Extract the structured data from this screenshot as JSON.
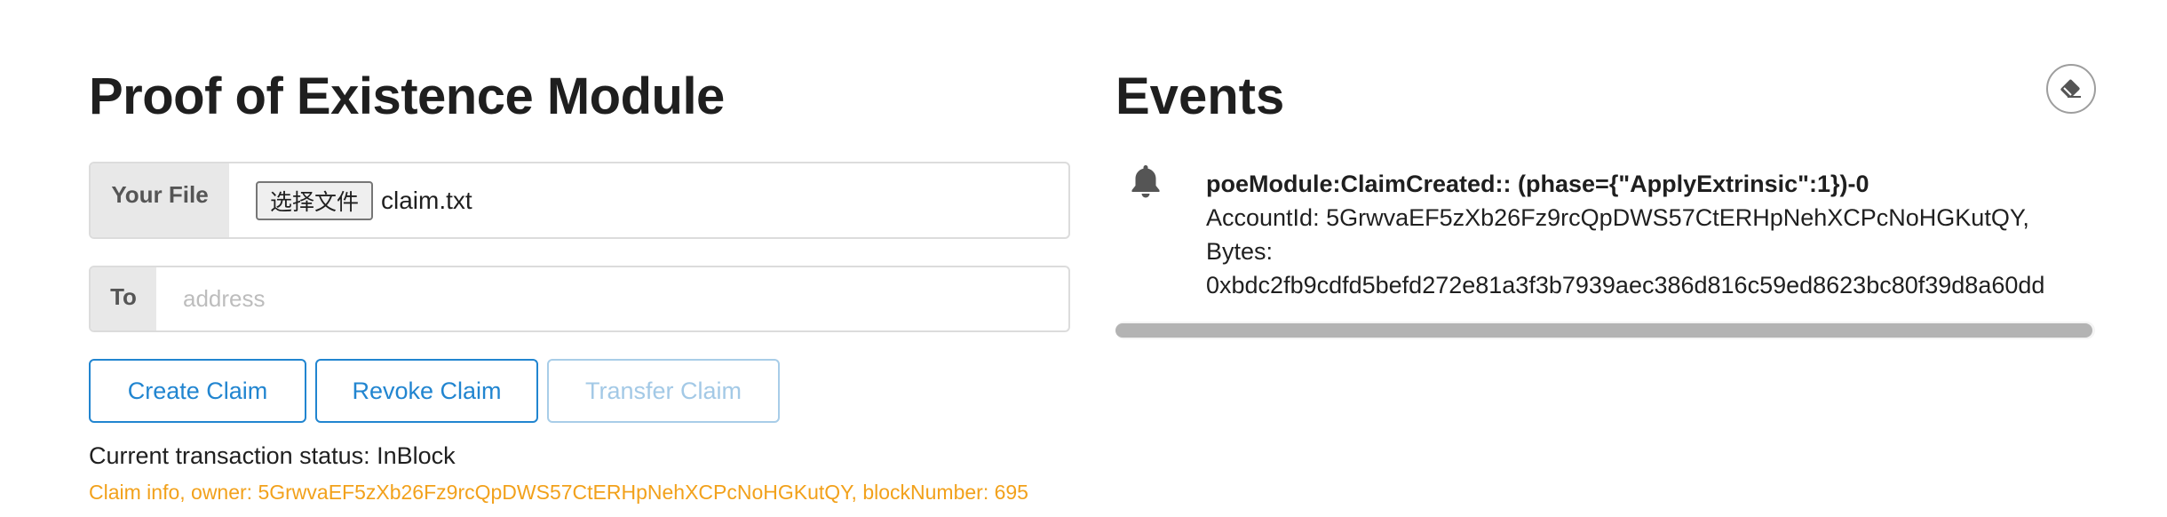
{
  "poe": {
    "title": "Proof of Existence Module",
    "file_label": "Your File",
    "choose_button": "选择文件",
    "file_name": "claim.txt",
    "to_label": "To",
    "to_placeholder": "address",
    "to_value": "",
    "buttons": {
      "create": "Create Claim",
      "revoke": "Revoke Claim",
      "transfer": "Transfer Claim"
    },
    "status": "Current transaction status: InBlock",
    "claim_info": "Claim info, owner: 5GrwvaEF5zXb26Fz9rcQpDWS57CtERHpNehXCPcNoHGKutQY, blockNumber: 695"
  },
  "events": {
    "title": "Events",
    "clear_icon": "eraser-icon",
    "items": [
      {
        "icon": "bell-icon",
        "title": "poeModule:ClaimCreated:: (phase={\"ApplyExtrinsic\":1})-0",
        "account": "AccountId: 5GrwvaEF5zXb26Fz9rcQpDWS57CtERHpNehXCPcNoHGKutQY,",
        "bytes_label": "Bytes:",
        "bytes_value": "0xbdc2fb9cdfd5befd272e81a3f3b7939aec386d816c59ed8623bc80f39d8a60dd"
      }
    ]
  },
  "colors": {
    "accent": "#2185d0",
    "accent_disabled": "#a3c9e6",
    "claim_info": "#f2a11b"
  }
}
